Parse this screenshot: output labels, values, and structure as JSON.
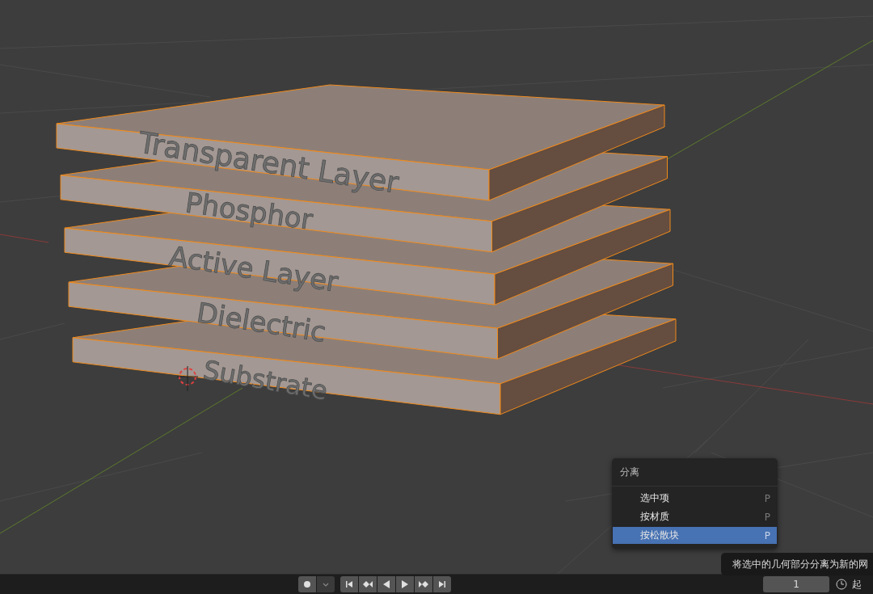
{
  "viewport": {
    "layer_labels": [
      "Transparent Layer",
      "Phosphor",
      "Active Layer",
      "Dielectric",
      "Substrate"
    ]
  },
  "menu": {
    "title": "分离",
    "items": [
      {
        "label": "选中项",
        "shortcut": "P",
        "selected": false
      },
      {
        "label": "按材质",
        "shortcut": "P",
        "selected": false
      },
      {
        "label": "按松散块",
        "shortcut": "P",
        "selected": true
      }
    ]
  },
  "tooltip": {
    "text": "将选中的几何部分分离为新的网"
  },
  "timeline": {
    "frame": "1",
    "start_label": "起"
  }
}
